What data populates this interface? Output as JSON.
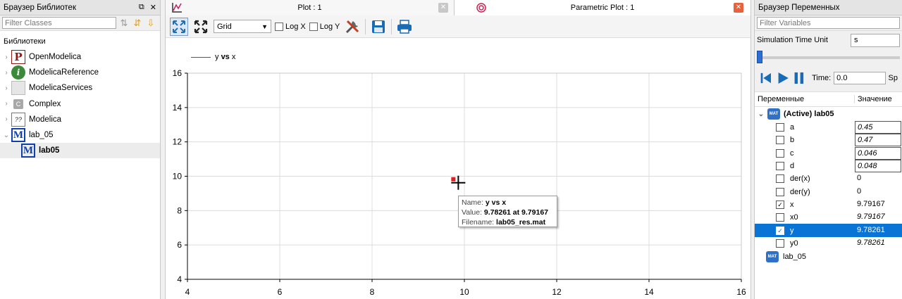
{
  "library_browser": {
    "title": "Браузер Библиотек",
    "filter_placeholder": "Filter Classes",
    "libraries_label": "Библиотеки",
    "items": [
      {
        "label": "OpenModelica",
        "icon": "openmodelica-icon"
      },
      {
        "label": "ModelicaReference",
        "icon": "info-icon"
      },
      {
        "label": "ModelicaServices",
        "icon": "services-icon"
      },
      {
        "label": "Complex",
        "icon": "complex-icon"
      },
      {
        "label": "Modelica",
        "icon": "modelica-icon"
      },
      {
        "label": "lab_05",
        "icon": "model-icon"
      },
      {
        "label": "lab05",
        "icon": "model-icon"
      }
    ]
  },
  "tabs": [
    {
      "label": "Plot : 1"
    },
    {
      "label": "Parametric Plot : 1"
    }
  ],
  "toolbar": {
    "grid_value": "Grid",
    "log_x": "Log X",
    "log_y": "Log Y"
  },
  "plot": {
    "legend": {
      "y": "y",
      "vs": "vs",
      "x": "x"
    },
    "colors": {
      "series": "#e02020",
      "grid": "#dcdcdc"
    }
  },
  "tooltip": {
    "name_label": "Name:",
    "name_value": "y vs x",
    "value_label": "Value:",
    "value_value": "9.78261 at 9.79167",
    "file_label": "Filename:",
    "file_value": "lab05_res.mat"
  },
  "variables_browser": {
    "title": "Браузер Переменных",
    "filter_placeholder": "Filter Variables",
    "sim_time_unit_label": "Simulation Time Unit",
    "sim_time_unit_value": "s",
    "time_label": "Time:",
    "time_value": "0.0",
    "speed_label": "Sp",
    "col_vars": "Переменные",
    "col_value": "Значение",
    "active_model": "(Active) lab05",
    "rows": [
      {
        "name": "a",
        "value": "0.45",
        "checked": false,
        "editable": true
      },
      {
        "name": "b",
        "value": "0.47",
        "checked": false,
        "editable": true
      },
      {
        "name": "c",
        "value": "0.046",
        "checked": false,
        "editable": true
      },
      {
        "name": "d",
        "value": "0.048",
        "checked": false,
        "editable": true
      },
      {
        "name": "der(x)",
        "value": "0",
        "checked": false,
        "editable": false
      },
      {
        "name": "der(y)",
        "value": "0",
        "checked": false,
        "editable": false
      },
      {
        "name": "x",
        "value": "9.79167",
        "checked": true,
        "editable": false
      },
      {
        "name": "x0",
        "value": "9.79167",
        "checked": false,
        "editable": false,
        "italic": true
      },
      {
        "name": "y",
        "value": "9.78261",
        "checked": true,
        "editable": false,
        "selected": true
      },
      {
        "name": "y0",
        "value": "9.78261",
        "checked": false,
        "editable": false,
        "italic": true
      }
    ],
    "other_model": "lab_05"
  },
  "chart_data": {
    "type": "scatter",
    "x": [
      9.79167
    ],
    "y": [
      9.78261
    ],
    "xlim": [
      4,
      16
    ],
    "ylim": [
      4,
      16
    ],
    "xticks": [
      4,
      6,
      8,
      10,
      12,
      14,
      16
    ],
    "yticks": [
      4,
      6,
      8,
      10,
      12,
      14,
      16
    ],
    "grid": true,
    "series": [
      {
        "name": "y vs x",
        "x": [
          9.79167
        ],
        "y": [
          9.78261
        ]
      }
    ],
    "legend_position": "top-left"
  }
}
